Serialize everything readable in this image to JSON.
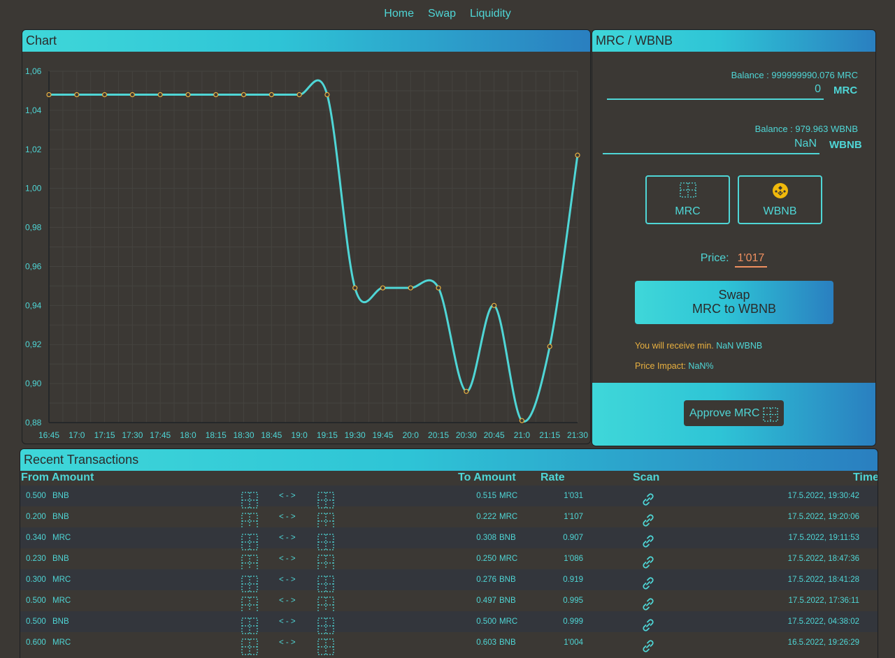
{
  "nav": {
    "home": "Home",
    "swap": "Swap",
    "liquidity": "Liquidity"
  },
  "chart_panel": {
    "title": "Chart"
  },
  "chart_data": {
    "type": "line",
    "x": [
      "16:45",
      "17:0",
      "17:15",
      "17:30",
      "17:45",
      "18:0",
      "18:15",
      "18:30",
      "18:45",
      "19:0",
      "19:15",
      "19:30",
      "19:45",
      "20:0",
      "20:15",
      "20:30",
      "20:45",
      "21:0",
      "21:15",
      "21:30"
    ],
    "values": [
      1.048,
      1.048,
      1.048,
      1.048,
      1.048,
      1.048,
      1.048,
      1.048,
      1.048,
      1.048,
      1.048,
      0.949,
      0.949,
      0.949,
      0.949,
      0.896,
      0.94,
      0.881,
      0.919,
      1.017
    ],
    "ylim": [
      0.88,
      1.06
    ],
    "yticks": [
      "1,06",
      "1,04",
      "1,02",
      "1,00",
      "0,98",
      "0,96",
      "0,94",
      "0,92",
      "0,90",
      "0,88"
    ],
    "line_color": "#4fd6d6",
    "point_color": "#e8b040",
    "grid": true
  },
  "swap": {
    "title": "MRC / WBNB",
    "from": {
      "balance": "Balance : 999999990.076 MRC",
      "value": "0",
      "token": "MRC"
    },
    "to": {
      "balance": "Balance : 979.963 WBNB",
      "value": "NaN",
      "token": "WBNB"
    },
    "token_buttons": [
      {
        "label": "MRC",
        "icon": "grid-icon"
      },
      {
        "label": "WBNB",
        "icon": "bnb-coin-icon"
      }
    ],
    "price_label": "Price:",
    "price_value": "1'017",
    "swap_button_line1": "Swap",
    "swap_button_line2": "MRC to WBNB",
    "receive_label": "You will receive min. ",
    "receive_value": "NaN WBNB",
    "impact_label": "Price Impact: ",
    "impact_value": "NaN%",
    "approve_button": "Approve MRC"
  },
  "transactions": {
    "title": "Recent Transactions",
    "columns": {
      "from": "From Amount",
      "to": "To Amount",
      "rate": "Rate",
      "scan": "Scan",
      "time": "Time"
    },
    "arrow": "< - >",
    "rows": [
      {
        "from_amount": "0.500",
        "from_token": "BNB",
        "to_amount": "0.515",
        "to_token": "MRC",
        "rate": "1'031",
        "time": "17.5.2022, 19:30:42"
      },
      {
        "from_amount": "0.200",
        "from_token": "BNB",
        "to_amount": "0.222",
        "to_token": "MRC",
        "rate": "1'107",
        "time": "17.5.2022, 19:20:06"
      },
      {
        "from_amount": "0.340",
        "from_token": "MRC",
        "to_amount": "0.308",
        "to_token": "BNB",
        "rate": "0.907",
        "time": "17.5.2022, 19:11:53"
      },
      {
        "from_amount": "0.230",
        "from_token": "BNB",
        "to_amount": "0.250",
        "to_token": "MRC",
        "rate": "1'086",
        "time": "17.5.2022, 18:47:36"
      },
      {
        "from_amount": "0.300",
        "from_token": "MRC",
        "to_amount": "0.276",
        "to_token": "BNB",
        "rate": "0.919",
        "time": "17.5.2022, 18:41:28"
      },
      {
        "from_amount": "0.500",
        "from_token": "MRC",
        "to_amount": "0.497",
        "to_token": "BNB",
        "rate": "0.995",
        "time": "17.5.2022, 17:36:11"
      },
      {
        "from_amount": "0.500",
        "from_token": "BNB",
        "to_amount": "0.500",
        "to_token": "MRC",
        "rate": "0.999",
        "time": "17.5.2022, 04:38:02"
      },
      {
        "from_amount": "0.600",
        "from_token": "MRC",
        "to_amount": "0.603",
        "to_token": "BNB",
        "rate": "1'004",
        "time": "16.5.2022, 19:26:29"
      }
    ]
  }
}
